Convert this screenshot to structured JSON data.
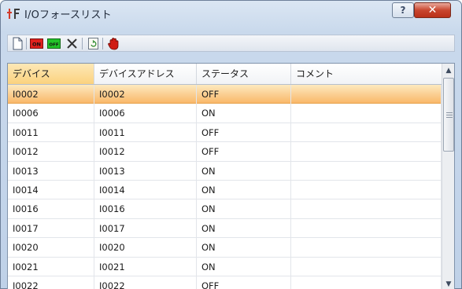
{
  "window": {
    "title": "I/Oフォースリスト"
  },
  "titlebar_buttons": {
    "help": "?",
    "close": "✕"
  },
  "toolbar": {
    "tools": [
      {
        "name": "new-icon"
      },
      {
        "name": "force-on-icon",
        "label": "ON"
      },
      {
        "name": "force-off-icon",
        "label": "OFF"
      },
      {
        "name": "delete-icon"
      },
      {
        "name": "refresh-icon"
      },
      {
        "name": "stop-hand-icon"
      }
    ]
  },
  "table": {
    "columns": [
      "デバイス",
      "デバイスアドレス",
      "ステータス",
      "コメント"
    ],
    "rows": [
      {
        "device": "I0002",
        "address": "I0002",
        "status": "OFF",
        "comment": ""
      },
      {
        "device": "I0006",
        "address": "I0006",
        "status": "ON",
        "comment": ""
      },
      {
        "device": "I0011",
        "address": "I0011",
        "status": "OFF",
        "comment": ""
      },
      {
        "device": "I0012",
        "address": "I0012",
        "status": "OFF",
        "comment": ""
      },
      {
        "device": "I0013",
        "address": "I0013",
        "status": "ON",
        "comment": ""
      },
      {
        "device": "I0014",
        "address": "I0014",
        "status": "ON",
        "comment": ""
      },
      {
        "device": "I0016",
        "address": "I0016",
        "status": "ON",
        "comment": ""
      },
      {
        "device": "I0017",
        "address": "I0017",
        "status": "ON",
        "comment": ""
      },
      {
        "device": "I0020",
        "address": "I0020",
        "status": "ON",
        "comment": ""
      },
      {
        "device": "I0021",
        "address": "I0021",
        "status": "ON",
        "comment": ""
      },
      {
        "device": "I0022",
        "address": "I0022",
        "status": "OFF",
        "comment": ""
      }
    ],
    "selected_row": 0,
    "sorted_column": 0
  },
  "colors": {
    "selection": "#f9b86a",
    "header_sorted": "#fbd27e",
    "close": "#c9462f"
  }
}
